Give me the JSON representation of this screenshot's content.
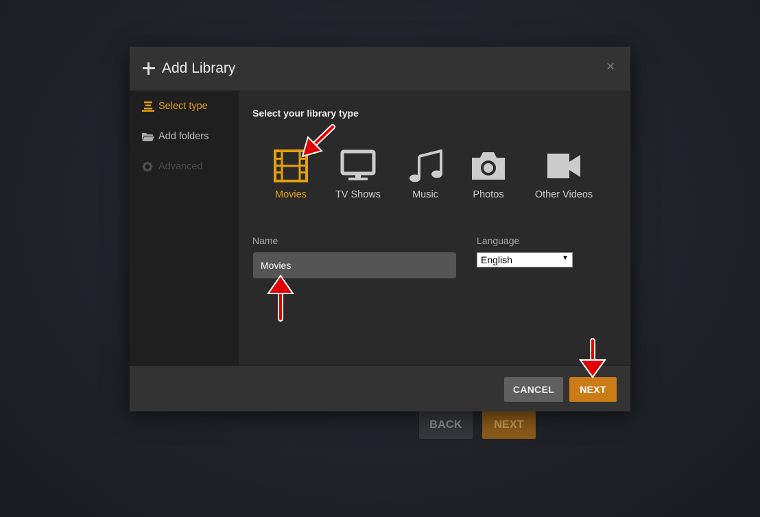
{
  "background": {
    "back_label": "BACK",
    "next_label": "NEXT"
  },
  "modal": {
    "title": "Add Library",
    "close_glyph": "×"
  },
  "sidebar": {
    "items": [
      {
        "label": "Select type",
        "icon": "list-icon",
        "state": "active"
      },
      {
        "label": "Add folders",
        "icon": "folder-icon",
        "state": "normal"
      },
      {
        "label": "Advanced",
        "icon": "gear-icon",
        "state": "disabled"
      }
    ]
  },
  "content": {
    "title": "Select your library type",
    "types": [
      {
        "label": "Movies",
        "icon": "film-icon",
        "selected": true
      },
      {
        "label": "TV Shows",
        "icon": "tv-icon",
        "selected": false
      },
      {
        "label": "Music",
        "icon": "music-note-icon",
        "selected": false
      },
      {
        "label": "Photos",
        "icon": "camera-icon",
        "selected": false
      },
      {
        "label": "Other Videos",
        "icon": "video-camera-icon",
        "selected": false
      }
    ],
    "name_label": "Name",
    "name_value": "Movies",
    "language_label": "Language",
    "language_value": "English"
  },
  "footer": {
    "cancel_label": "CANCEL",
    "next_label": "NEXT"
  },
  "colors": {
    "accent": "#e5a00d",
    "next_button": "#cc7b19",
    "annotation_arrow": "#e00000"
  }
}
